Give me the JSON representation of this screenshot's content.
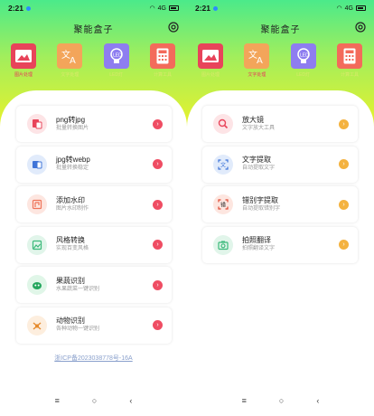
{
  "status": {
    "time": "2:21",
    "net": "4G"
  },
  "app": {
    "title": "聚能盒子"
  },
  "tabs": [
    {
      "label": "图片处理",
      "icon": "image-icon",
      "color": "#e8445a"
    },
    {
      "label": "文字处理",
      "icon": "translate-icon",
      "color": "#f3a55a"
    },
    {
      "label": "LED灯",
      "icon": "bulb-icon",
      "color": "#8e7df0"
    },
    {
      "label": "计算工具",
      "icon": "calculator-icon",
      "color": "#f36b5b"
    }
  ],
  "left_list": [
    {
      "name": "png转jpg",
      "desc": "批量转换图片",
      "icon": "file-convert-icon",
      "icon_bg": "#fde4e6",
      "icon_color": "#e8445a"
    },
    {
      "name": "jpg转webp",
      "desc": "批量转换稳定",
      "icon": "file-convert-icon",
      "icon_bg": "#e1ebfb",
      "icon_color": "#3f74d8"
    },
    {
      "name": "添加水印",
      "desc": "图片水印制作",
      "icon": "watermark-icon",
      "icon_bg": "#fde6e0",
      "icon_color": "#ef7459"
    },
    {
      "name": "风格转换",
      "desc": "实现百变风格",
      "icon": "style-icon",
      "icon_bg": "#e1f5ea",
      "icon_color": "#3bb97a"
    },
    {
      "name": "果蔬识别",
      "desc": "水果蔬菜一键识别",
      "icon": "fruit-icon",
      "icon_bg": "#e0f6e8",
      "icon_color": "#25a75e"
    },
    {
      "name": "动物识别",
      "desc": "各种动物一键识别",
      "icon": "animal-icon",
      "icon_bg": "#fdeede",
      "icon_color": "#e58a2c"
    }
  ],
  "right_list": [
    {
      "name": "放大镜",
      "desc": "文字放大工具",
      "icon": "magnifier-icon",
      "icon_bg": "#fde4e6",
      "icon_color": "#e8445a"
    },
    {
      "name": "文字提取",
      "desc": "自动提取文字",
      "icon": "text-extract-icon",
      "icon_bg": "#e1ebfb",
      "icon_color": "#3f74d8"
    },
    {
      "name": "错别字提取",
      "desc": "自动提取错别字",
      "icon": "typo-icon",
      "icon_bg": "#fde6e0",
      "icon_color": "#e04a35"
    },
    {
      "name": "拍照翻译",
      "desc": "拍照翻译文字",
      "icon": "camera-icon",
      "icon_bg": "#e1f5ea",
      "icon_color": "#3bb97a"
    }
  ],
  "colors": {
    "arrow_left": "#ef4d63",
    "arrow_right": "#f4b23f"
  },
  "footer": {
    "icp": "浙ICP备2023038778号-16A"
  },
  "nav": {
    "menu": "≡",
    "home": "○",
    "back": "‹"
  }
}
